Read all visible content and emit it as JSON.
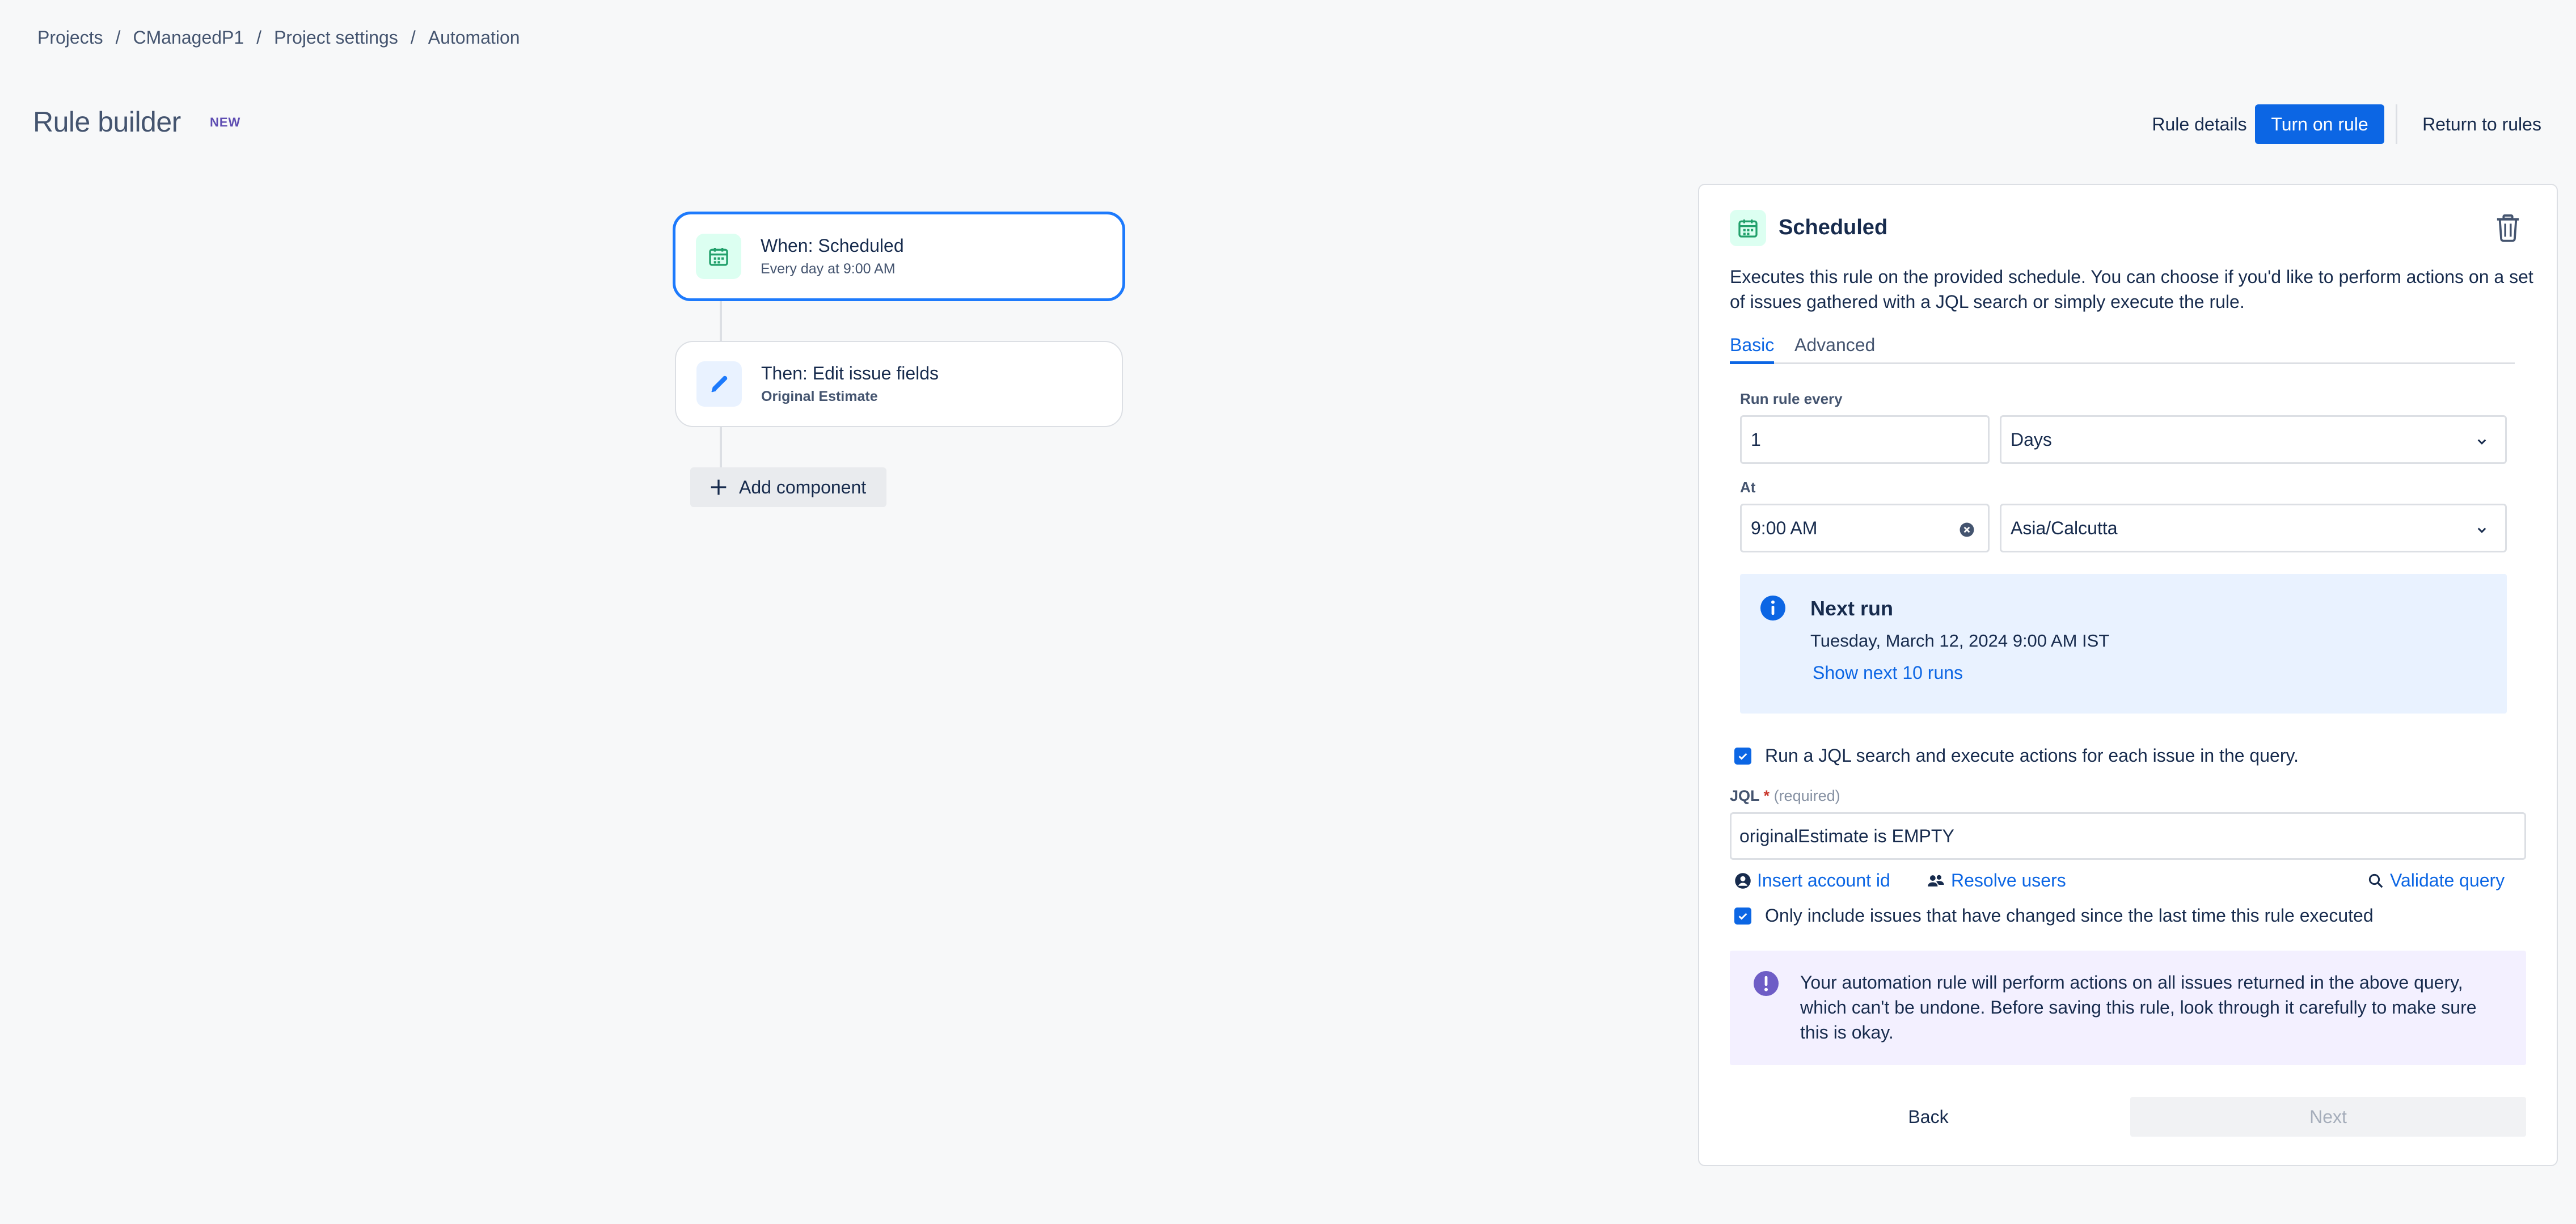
{
  "breadcrumb": [
    "Projects",
    "CManagedP1",
    "Project settings",
    "Automation"
  ],
  "breadcrumb_separator": "/",
  "header": {
    "title": "Rule builder",
    "badge": "NEW",
    "rule_details_label": "Rule details",
    "turn_on_label": "Turn on rule",
    "return_label": "Return to rules"
  },
  "flow": {
    "trigger": {
      "title": "When: Scheduled",
      "subtitle": "Every day at 9:00 AM",
      "icon": "calendar-icon"
    },
    "action": {
      "title": "Then: Edit issue fields",
      "subtitle": "Original Estimate",
      "icon": "pencil-icon"
    },
    "add_component_label": "Add component"
  },
  "panel": {
    "title": "Scheduled",
    "description": "Executes this rule on the provided schedule. You can choose if you'd like to perform actions on a set of issues gathered with a JQL search or simply execute the rule.",
    "tabs": [
      "Basic",
      "Advanced"
    ],
    "active_tab": "Basic",
    "run_every": {
      "label": "Run rule every",
      "value": "1",
      "unit": "Days"
    },
    "at": {
      "label": "At",
      "time": "9:00 AM",
      "timezone": "Asia/Calcutta"
    },
    "next_run": {
      "title": "Next run",
      "date": "Tuesday, March 12, 2024 9:00 AM IST",
      "link": "Show next 10 runs"
    },
    "jql_checkbox": {
      "label": "Run a JQL search and execute actions for each issue in the query.",
      "checked": true
    },
    "jql": {
      "label": "JQL",
      "required_mark": "*",
      "required_text": "(required)",
      "value": "originalEstimate is EMPTY"
    },
    "links": {
      "insert_account": "Insert account id",
      "resolve_users": "Resolve users",
      "validate": "Validate query"
    },
    "changed_checkbox": {
      "label": "Only include issues that have changed since the last time this rule executed",
      "checked": true
    },
    "warning": "Your automation rule will perform actions on all issues returned in the above query, which can't be undone. Before saving this rule, look through it carefully to make sure this is okay.",
    "back_label": "Back",
    "next_label": "Next"
  },
  "colors": {
    "primary": "#0c66e4",
    "trigger_border": "#1d7afc",
    "info_bg": "#e9f2ff",
    "warning_bg": "#f3f0ff",
    "discovery_icon": "#6e5dc6",
    "success_icon": "#22a06b"
  }
}
